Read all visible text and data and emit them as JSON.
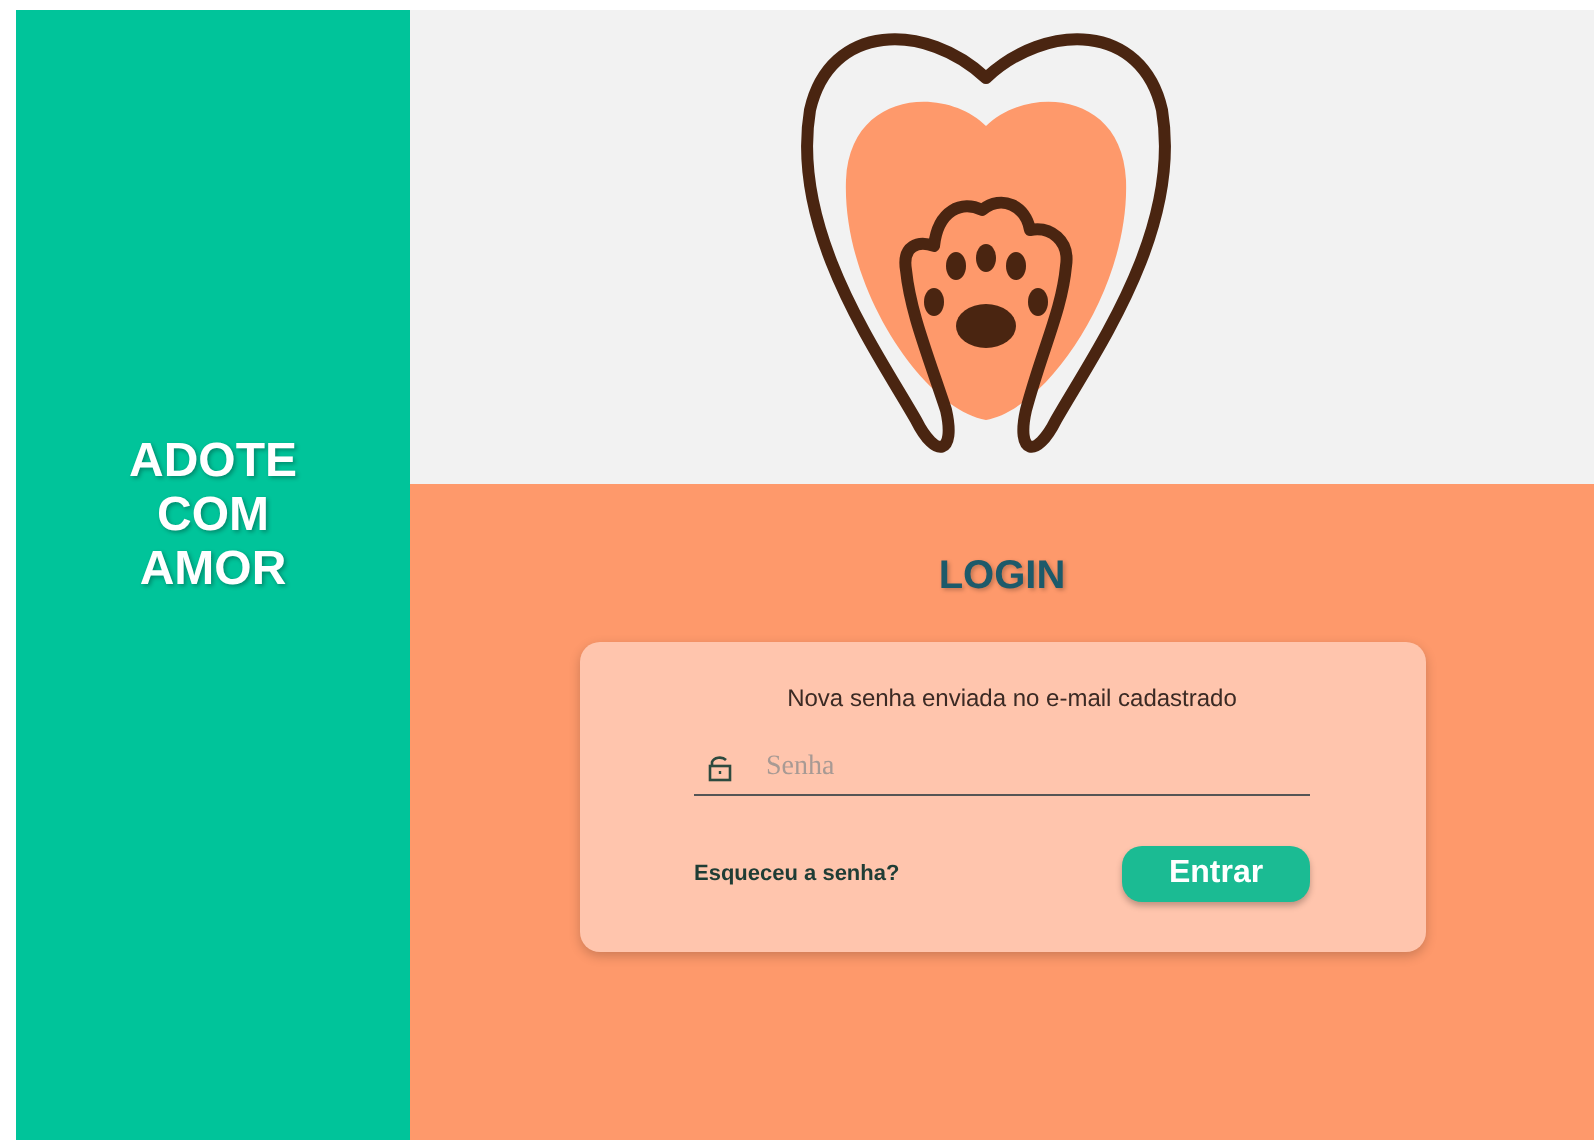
{
  "brand": {
    "title": "ADOTE COM AMOR"
  },
  "login": {
    "heading": "LOGIN",
    "message": "Nova senha enviada no e-mail cadastrado",
    "password": {
      "placeholder": "Senha"
    },
    "forgot_link": "Esqueceu a senha?",
    "submit": "Entrar"
  }
}
